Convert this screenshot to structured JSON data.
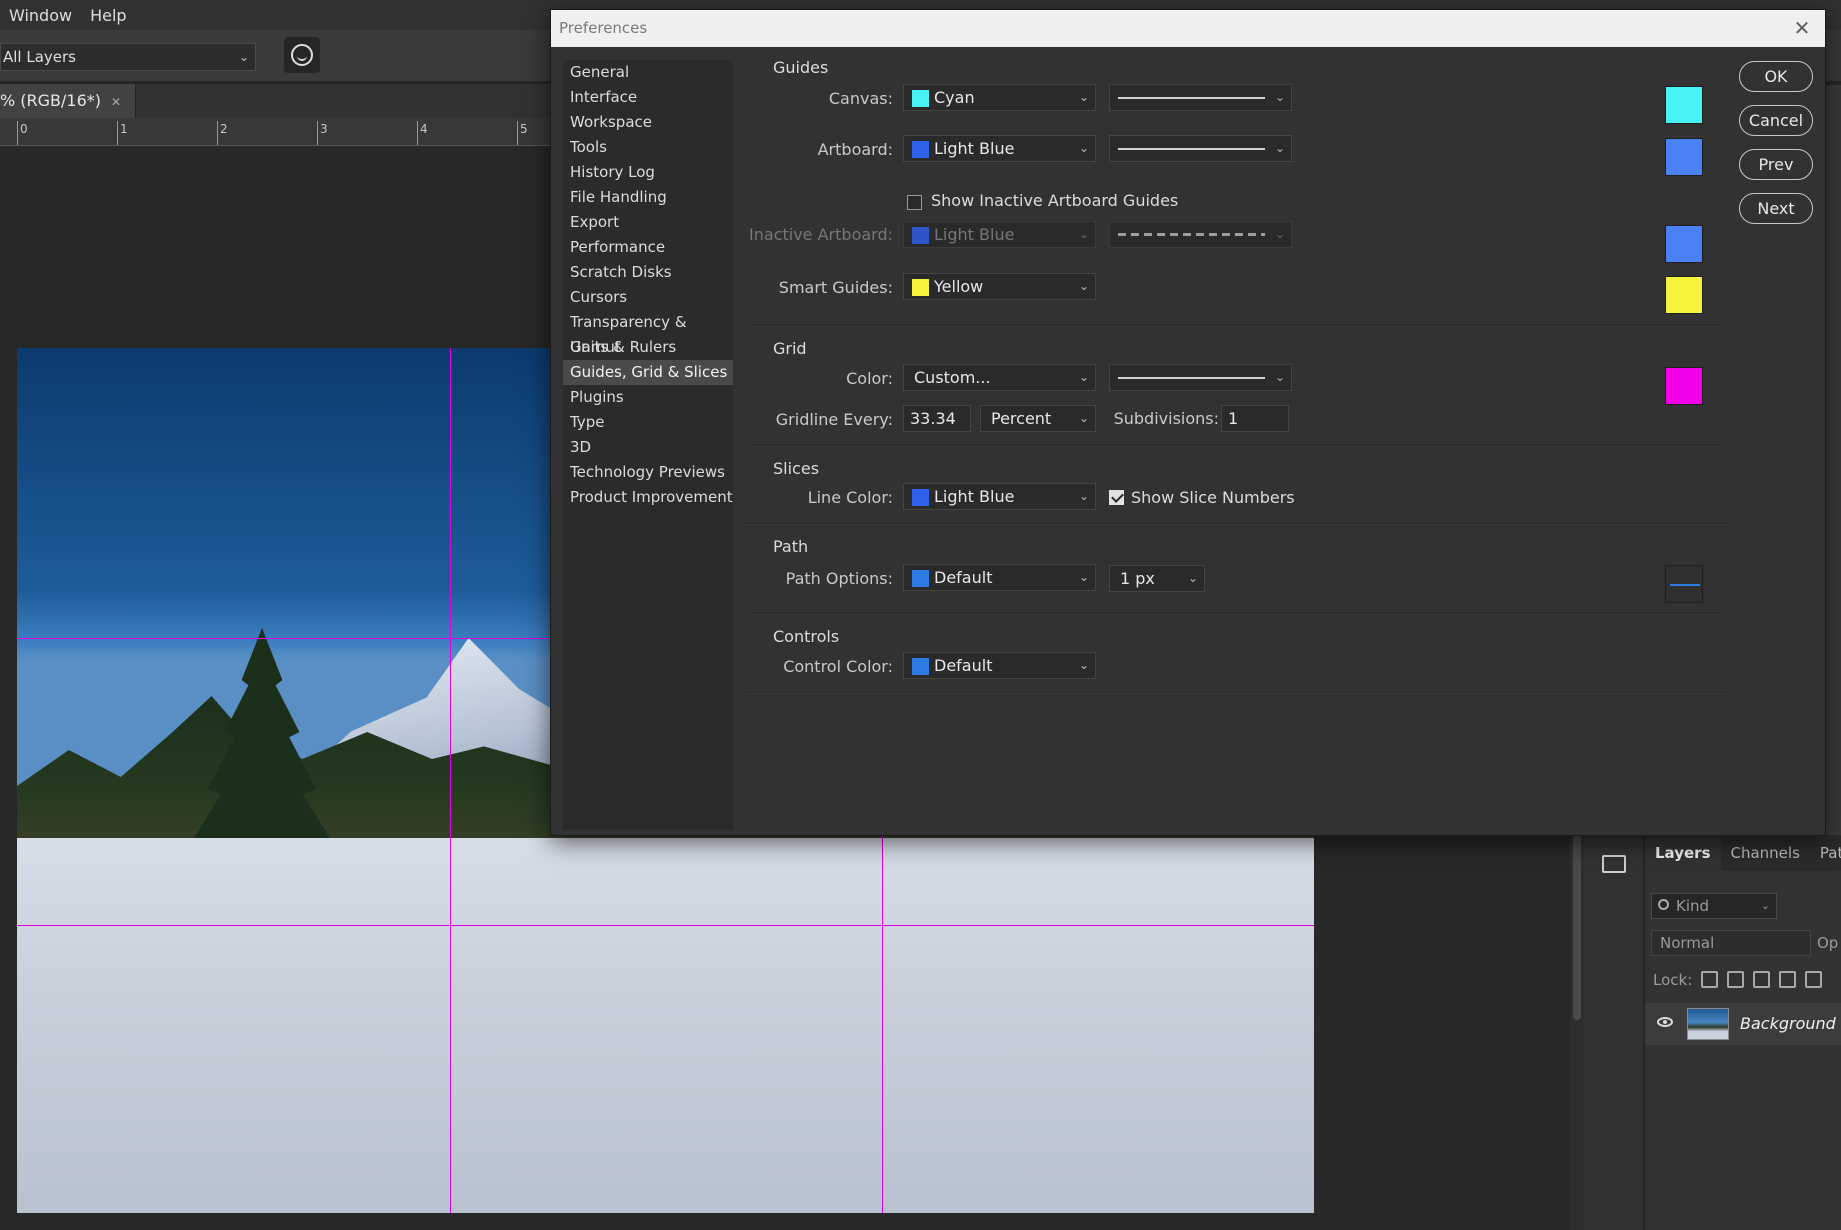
{
  "menubar": {
    "items": [
      "Window",
      "Help"
    ]
  },
  "options_bar": {
    "layer_select": "All Layers"
  },
  "document": {
    "tab_title": "% (RGB/16*)",
    "ruler_ticks": [
      "0",
      "1",
      "2",
      "3",
      "4",
      "5"
    ]
  },
  "layers_panel": {
    "tabs": [
      "Layers",
      "Channels",
      "Paths"
    ],
    "kind_placeholder": "Kind",
    "blend_mode": "Normal",
    "opacity_label": "Op",
    "lock_label": "Lock:",
    "layer_name": "Background"
  },
  "dialog": {
    "title": "Preferences",
    "nav_items": [
      "General",
      "Interface",
      "Workspace",
      "Tools",
      "History Log",
      "File Handling",
      "Export",
      "Performance",
      "Scratch Disks",
      "Cursors",
      "Transparency & Gamut",
      "Units & Rulers",
      "Guides, Grid & Slices",
      "Plugins",
      "Type",
      "3D",
      "Technology Previews",
      "Product Improvement"
    ],
    "active_nav": "Guides, Grid & Slices",
    "buttons": {
      "ok": "OK",
      "cancel": "Cancel",
      "prev": "Prev",
      "next": "Next"
    },
    "guides": {
      "title": "Guides",
      "canvas_label": "Canvas:",
      "canvas_color": "Cyan",
      "artboard_label": "Artboard:",
      "artboard_color": "Light Blue",
      "show_inactive_label": "Show Inactive Artboard Guides",
      "show_inactive_checked": false,
      "inactive_label": "Inactive Artboard:",
      "inactive_color": "Light Blue",
      "smart_label": "Smart Guides:",
      "smart_color": "Yellow"
    },
    "grid": {
      "title": "Grid",
      "color_label": "Color:",
      "color_value": "Custom...",
      "gridline_label": "Gridline Every:",
      "gridline_value": "33.34",
      "gridline_unit": "Percent",
      "subdivisions_label": "Subdivisions:",
      "subdivisions_value": "1"
    },
    "slices": {
      "title": "Slices",
      "line_color_label": "Line Color:",
      "line_color": "Light Blue",
      "show_numbers_label": "Show Slice Numbers",
      "show_numbers_checked": true
    },
    "path": {
      "title": "Path",
      "options_label": "Path Options:",
      "color": "Default",
      "width": "1 px"
    },
    "controls": {
      "title": "Controls",
      "color_label": "Control Color:",
      "color": "Default"
    },
    "swatch_colors": {
      "canvas": "#48f3f6",
      "artboard": "#4a82f5",
      "inactive": "#4a82f5",
      "smart": "#f6f43a",
      "grid": "#ef00e8",
      "path": "#2f7be4"
    }
  }
}
